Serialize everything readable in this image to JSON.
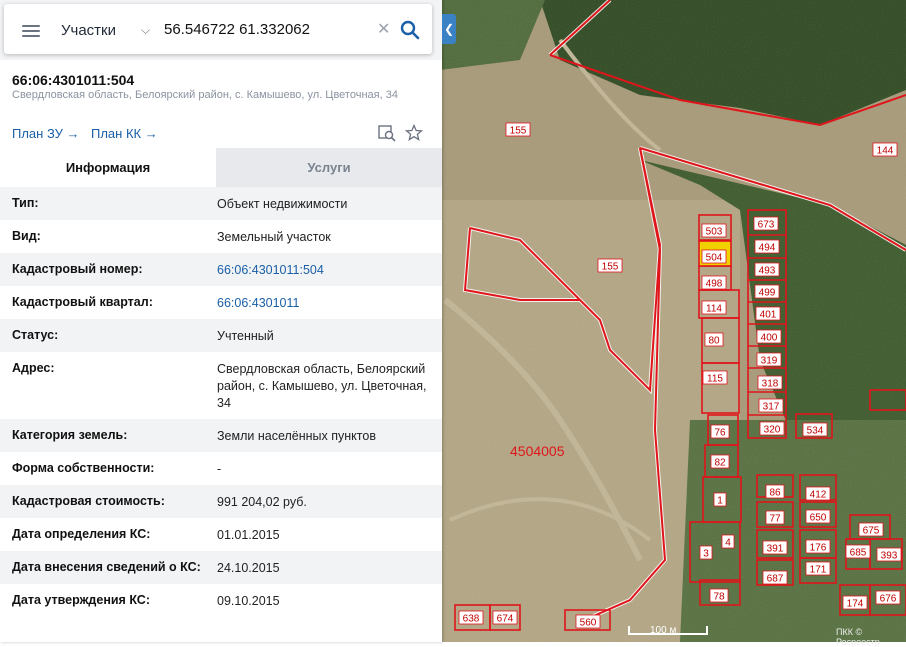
{
  "search": {
    "category": "Участки",
    "query": "56.546722 61.332062"
  },
  "object": {
    "cadastral_number": "66:06:4301011:504",
    "address_line": "Свердловская область, Белоярский район, с. Камышево, ул. Цветочная, 34"
  },
  "links": {
    "plan_zu": "План ЗУ →",
    "plan_kk": "План КК →"
  },
  "tabs": {
    "info": "Информация",
    "services": "Услуги"
  },
  "rows": [
    {
      "key": "Тип:",
      "value": "Объект недвижимости"
    },
    {
      "key": "Вид:",
      "value": "Земельный участок"
    },
    {
      "key": "Кадастровый номер:",
      "value": "66:06:4301011:504"
    },
    {
      "key": "Кадастровый квартал:",
      "value": "66:06:4301011"
    },
    {
      "key": "Статус:",
      "value": "Учтенный"
    },
    {
      "key": "Адрес:",
      "value": "Свердловская область, Белоярский район, с. Камышево, ул. Цветочная, 34"
    },
    {
      "key": "Категория земель:",
      "value": "Земли населённых пунктов"
    },
    {
      "key": "Форма собственности:",
      "value": "-"
    },
    {
      "key": "Кадастровая стоимость:",
      "value": "991 204,02 руб."
    },
    {
      "key": "Дата определения КС:",
      "value": "01.01.2015"
    },
    {
      "key": "Дата внесения сведений о КС:",
      "value": "24.10.2015"
    },
    {
      "key": "Дата утверждения КС:",
      "value": "09.10.2015"
    }
  ],
  "map": {
    "quarter_label": "4504005",
    "scale_label": "100 м",
    "copyright": "ПКК © Росреестр",
    "plot_labels": [
      "155",
      "155",
      "144",
      "503",
      "504",
      "498",
      "673",
      "494",
      "493",
      "499",
      "401",
      "400",
      "319",
      "318",
      "317",
      "320",
      "534",
      "114",
      "80",
      "115",
      "76",
      "82",
      "1",
      "3",
      "4",
      "86",
      "412",
      "77",
      "650",
      "391",
      "176",
      "687",
      "171",
      "675",
      "685",
      "393",
      "78",
      "174",
      "676",
      "638",
      "674",
      "560"
    ],
    "colors": {
      "boundary": "#e0151b",
      "selected_fill": "#f0d000",
      "forest": "#2f4a22",
      "field": "#a89a78"
    }
  }
}
